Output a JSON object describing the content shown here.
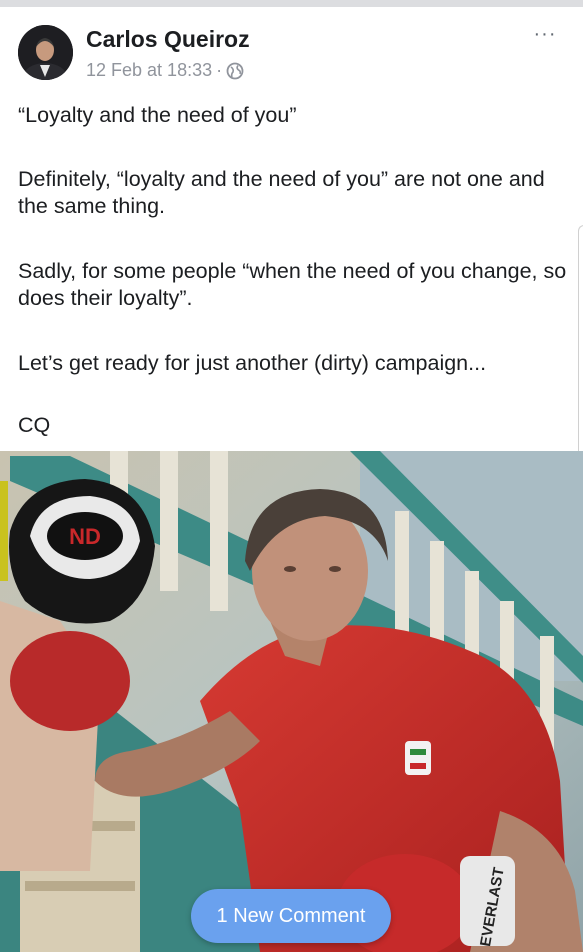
{
  "post": {
    "author": "Carlos Queiroz",
    "timestamp": "12 Feb at 18:33",
    "separator": "·",
    "privacy_icon": "globe-icon",
    "more_label": "···",
    "paragraphs": [
      "“Loyalty and the need of you”",
      "Definitely, “loyalty and the need of you” are not one and the same thing.",
      "Sadly, for some people “when the need of you change, so does their loyalty”.",
      "Let’s get ready for just another (dirty) campaign...",
      "CQ"
    ]
  },
  "banner": {
    "new_comment_label": "1 New Comment",
    "color": "#6aa1ee"
  },
  "photo": {
    "mitt_text": "ND",
    "glove_text": "EVERLAST"
  },
  "colors": {
    "text": "#1c1e21",
    "meta": "#90949c",
    "shirt": "#c8282a"
  }
}
